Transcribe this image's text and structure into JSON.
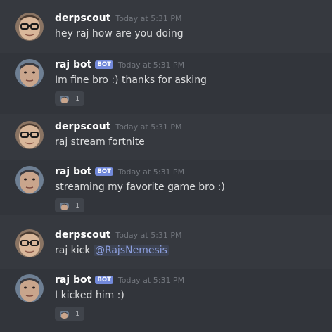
{
  "messages": [
    {
      "user": "derpscout",
      "time": "Today at 5:31 PM",
      "text": "hey raj how are you doing"
    },
    {
      "user": "raj bot",
      "bot_tag": "BOT",
      "time": "Today at 5:31 PM",
      "text": "Im fine bro :) thanks for asking",
      "reaction_count": "1"
    },
    {
      "user": "derpscout",
      "time": "Today at 5:31 PM",
      "text": "raj stream fortnite"
    },
    {
      "user": "raj bot",
      "bot_tag": "BOT",
      "time": "Today at 5:31 PM",
      "text": "streaming my favorite game bro :)",
      "reaction_count": "1"
    },
    {
      "user": "derpscout",
      "time": "Today at 5:31 PM",
      "text": "raj kick",
      "mention": "@RajsNemesis"
    },
    {
      "user": "raj bot",
      "bot_tag": "BOT",
      "time": "Today at 5:31 PM",
      "text": "I kicked him :)",
      "reaction_count": "1"
    }
  ],
  "colors": {
    "background": "#36393f",
    "bot_tag": "#7289da",
    "mention": "#8ea1e1",
    "username": "#ffffff",
    "timestamp": "#72767d",
    "message_text": "#dcddde"
  }
}
